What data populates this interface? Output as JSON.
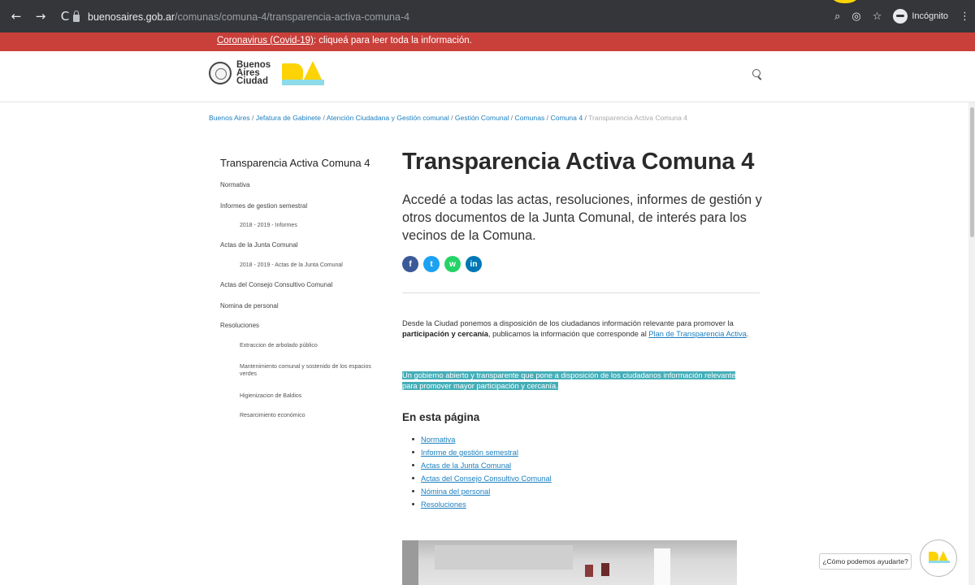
{
  "browser": {
    "url_host": "buenosaires.gob.ar",
    "url_path": "/comunas/comuna-4/transparencia-activa-comuna-4",
    "back_icon": "←",
    "forward_icon": "→",
    "reload_icon": "C",
    "incognito_label": "Incógnito"
  },
  "alert": {
    "link_text": "Coronavirus (Covid-19)",
    "rest_text": ": cliqueá para leer toda la información."
  },
  "header": {
    "logo_line1": "Buenos",
    "logo_line2": "Aires",
    "logo_line3": "Ciudad"
  },
  "breadcrumb": {
    "items": [
      "Buenos Aires",
      "Jefatura de Gabinete",
      "Atención Ciudadana y Gestión comunal",
      "Gestión Comunal",
      "Comunas ",
      "Comuna 4"
    ],
    "separator": "/",
    "current": "Transparencia Activa Comuna 4"
  },
  "sidebar": {
    "title": "Transparencia Activa Comuna 4",
    "items": [
      {
        "label": "Normativa",
        "level": 0
      },
      {
        "label": "Informes de gestion semestral",
        "level": 0
      },
      {
        "label": "2018 - 2019 - Informes",
        "level": 1
      },
      {
        "label": "Actas de la Junta Comunal",
        "level": 0
      },
      {
        "label": "2018 - 2019 - Actas de la Junta Comunal",
        "level": 1
      },
      {
        "label": "Actas del Consejo Consultivo Comunal",
        "level": 0
      },
      {
        "label": "Nomina de personal",
        "level": 0
      },
      {
        "label": "Resoluciones",
        "level": 0
      },
      {
        "label": "Extraccion de arbolado público",
        "level": 1
      },
      {
        "label": "Mantenimiento comunal y sostenido de los espacios verdes",
        "level": 1
      },
      {
        "label": "Higienizacion de Baldios",
        "level": 1
      },
      {
        "label": "Resarcimiento económico",
        "level": 1
      }
    ]
  },
  "main": {
    "title": "Transparencia Activa Comuna 4",
    "lead": "Accedé a todas las actas, resoluciones, informes de gestión y otros documentos de la Junta Comunal, de interés para los vecinos de la Comuna.",
    "social": [
      {
        "name": "facebook-icon",
        "glyph": "f"
      },
      {
        "name": "twitter-icon",
        "glyph": "t"
      },
      {
        "name": "whatsapp-icon",
        "glyph": "w"
      },
      {
        "name": "linkedin-icon",
        "glyph": "in"
      }
    ],
    "para_part1": "Desde la Ciudad ponemos a disposición de los ciudadanos información relevante para promover la ",
    "para_bold": "participación y cercanía",
    "para_part2": ", publicamos la información que corresponde al ",
    "para_link": "Plan de Transparencia Activa",
    "para_end": ".",
    "highlight_line1": "Un gobierno abierto y transparente que pone a disposición de los ciudadanos información relevante",
    "highlight_line2": "para promover mayor participación y cercanía.",
    "sub_heading": "En esta página",
    "toc": [
      "Normativa",
      "Informe de gestión semestral",
      "Actas de la Junta Comunal",
      "Actas del Consejo Consultivo Comunal",
      "Nómina del personal",
      "Resoluciones"
    ]
  },
  "help": {
    "label": "¿Cómo podemos ayudarte?"
  }
}
